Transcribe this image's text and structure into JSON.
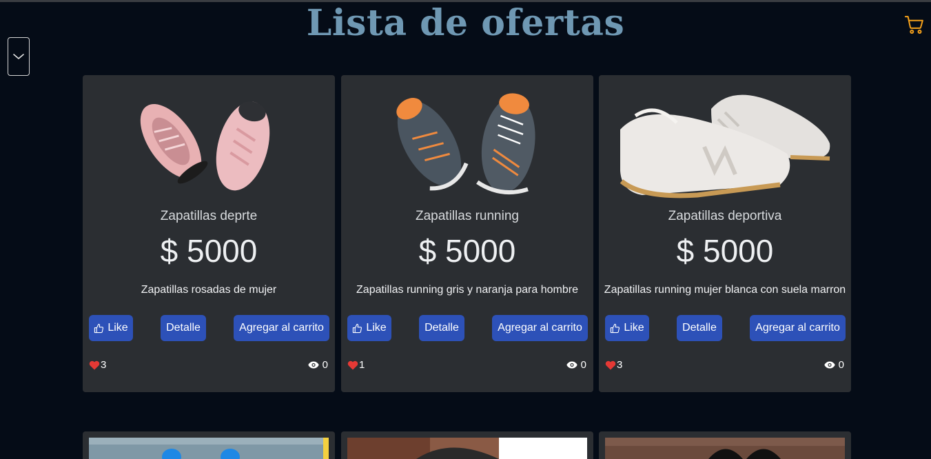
{
  "page": {
    "title": "Lista de ofertas"
  },
  "icons": {
    "cart": "cart-icon",
    "dropdown": "chevron-down-icon",
    "like": "thumbs-up-icon",
    "heart": "heart-icon",
    "eye": "eye-icon"
  },
  "colors": {
    "background": "#050c17",
    "card": "#2b2e32",
    "title": "#6f98b3",
    "button": "#2d51b8",
    "cart": "#f7a21b",
    "heart": "#e53935"
  },
  "products": [
    {
      "name": "Zapatillas deprte",
      "price": "$ 5000",
      "description": "Zapatillas rosadas de mujer",
      "like_label": "Like",
      "detail_label": "Detalle",
      "cart_label": "Agregar al carrito",
      "likes": "3",
      "views": "0"
    },
    {
      "name": "Zapatillas running",
      "price": "$ 5000",
      "description": "Zapatillas running gris y naranja para hombre",
      "like_label": "Like",
      "detail_label": "Detalle",
      "cart_label": "Agregar al carrito",
      "likes": "1",
      "views": "0"
    },
    {
      "name": "Zapatillas deportiva",
      "price": "$ 5000",
      "description": "Zapatillas running mujer blanca con suela marron",
      "like_label": "Like",
      "detail_label": "Detalle",
      "cart_label": "Agregar al carrito",
      "likes": "3",
      "views": "0"
    }
  ]
}
